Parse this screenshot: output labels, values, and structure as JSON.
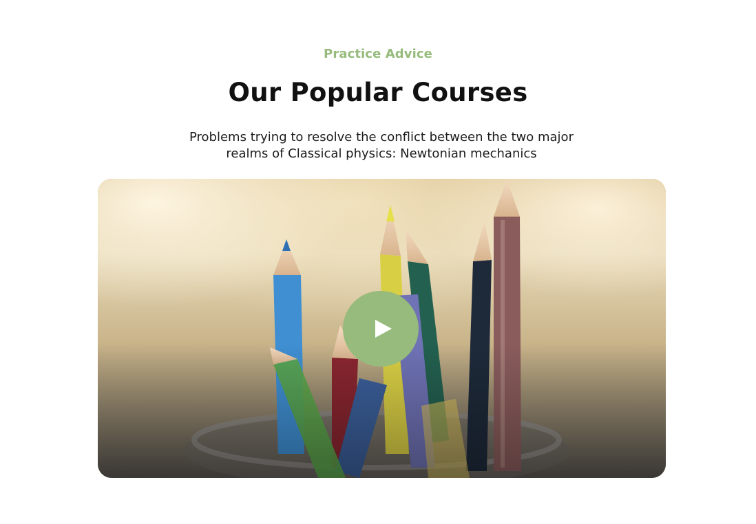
{
  "section": {
    "eyebrow": "Practice Advice",
    "title": "Our Popular Courses",
    "subtitle": "Problems trying to resolve the conflict between the two major realms of Classical physics: Newtonian mechanics"
  },
  "video": {
    "play_icon": "play-icon",
    "image_subject": "colored pencils in a mesh cup"
  },
  "colors": {
    "accent": "#96bb7c",
    "heading": "#111111",
    "body_text": "#1b1b1b",
    "background": "#ffffff"
  }
}
